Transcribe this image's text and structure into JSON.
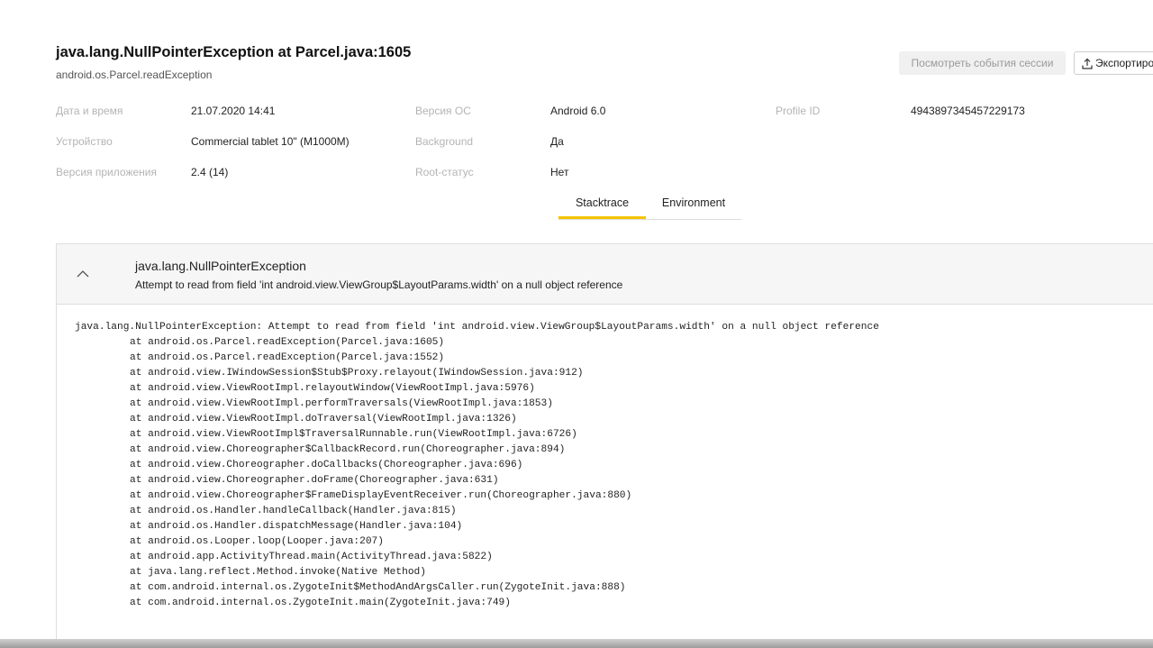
{
  "header": {
    "title": "java.lang.NullPointerException at Parcel.java:1605",
    "subtitle": "android.os.Parcel.readException",
    "view_session_events_label": "Посмотреть события сессии",
    "export_label": "Экспортиро"
  },
  "details": {
    "datetime": {
      "label": "Дата и время",
      "value": "21.07.2020 14:41"
    },
    "device": {
      "label": "Устройство",
      "value": "Commercial tablet 10\" (M1000M)"
    },
    "app_version": {
      "label": "Версия приложения",
      "value": "2.4 (14)"
    },
    "os_version": {
      "label": "Версия ОС",
      "value": "Android 6.0"
    },
    "background": {
      "label": "Background",
      "value": "Да"
    },
    "root_status": {
      "label": "Root-статус",
      "value": "Нет"
    },
    "profile_id": {
      "label": "Profile ID",
      "value": "4943897345457229173"
    }
  },
  "tabs": {
    "stacktrace": "Stacktrace",
    "environment": "Environment",
    "active": "stacktrace"
  },
  "exception": {
    "name": "java.lang.NullPointerException",
    "message": "Attempt to read from field 'int android.view.ViewGroup$LayoutParams.width' on a null object reference"
  },
  "stacktrace": {
    "first_line": "java.lang.NullPointerException: Attempt to read from field 'int android.view.ViewGroup$LayoutParams.width' on a null object reference",
    "frames": [
      "at android.os.Parcel.readException(Parcel.java:1605)",
      "at android.os.Parcel.readException(Parcel.java:1552)",
      "at android.view.IWindowSession$Stub$Proxy.relayout(IWindowSession.java:912)",
      "at android.view.ViewRootImpl.relayoutWindow(ViewRootImpl.java:5976)",
      "at android.view.ViewRootImpl.performTraversals(ViewRootImpl.java:1853)",
      "at android.view.ViewRootImpl.doTraversal(ViewRootImpl.java:1326)",
      "at android.view.ViewRootImpl$TraversalRunnable.run(ViewRootImpl.java:6726)",
      "at android.view.Choreographer$CallbackRecord.run(Choreographer.java:894)",
      "at android.view.Choreographer.doCallbacks(Choreographer.java:696)",
      "at android.view.Choreographer.doFrame(Choreographer.java:631)",
      "at android.view.Choreographer$FrameDisplayEventReceiver.run(Choreographer.java:880)",
      "at android.os.Handler.handleCallback(Handler.java:815)",
      "at android.os.Handler.dispatchMessage(Handler.java:104)",
      "at android.os.Looper.loop(Looper.java:207)",
      "at android.app.ActivityThread.main(ActivityThread.java:5822)",
      "at java.lang.reflect.Method.invoke(Native Method)",
      "at com.android.internal.os.ZygoteInit$MethodAndArgsCaller.run(ZygoteInit.java:888)",
      "at com.android.internal.os.ZygoteInit.main(ZygoteInit.java:749)"
    ]
  },
  "colors": {
    "accent": "#f5c400",
    "label": "#b4b4b4",
    "text": "#222222",
    "header_bg": "#f6f6f6"
  },
  "icons": {
    "export": "upload-icon",
    "toggle": "chevron-up-icon"
  }
}
